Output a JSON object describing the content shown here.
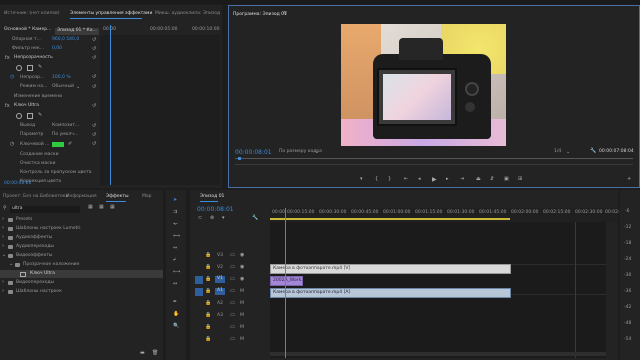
{
  "source_panel": {
    "tabs": [
      "Источник: (нет клипов)",
      "Элементы управления эффектами",
      "Микш. аудиоклипа: Эпизод"
    ],
    "clip_label": "Основной * Камер...",
    "seq_label": "Эпизод 01 * Ка...",
    "ruler_times": [
      "00:00",
      "00:00:05:00",
      "00:00:10:00"
    ],
    "props": [
      {
        "label": "Опорная т...",
        "value": "960,0  540,0"
      },
      {
        "label": "Фильтр нек...",
        "value": "0,00"
      }
    ],
    "opacity_label": "Непрозрачность",
    "opacity_value_label": "Непрозр...",
    "opacity_value": "100,0 %",
    "blend_label": "Режим на...",
    "blend_value": "Обычный",
    "time_remap": "Изменение времени",
    "ultra_key": "Ключ Ultra",
    "output_label": "Выход",
    "output_value": "Композит...",
    "setting_label": "Параметр",
    "setting_value": "По умолч...",
    "key_color_label": "Ключевой ...",
    "key_color": "#2ecc40",
    "sub_items": [
      "Создание маски",
      "Очистка маски",
      "Контроль за пропуском цвета",
      "Коррекция цвета"
    ],
    "timecode": "00:00:08:01"
  },
  "program_monitor": {
    "title": "Программа: Эпизод 01",
    "menu_icon": "menu-icon",
    "timecode": "00:00:08:01",
    "fit": "По размеру кадра",
    "quality": "1/4",
    "duration": "00:00:07:08:04"
  },
  "project_panel": {
    "tabs": [
      "Проект: Без на...",
      "Библиотеки",
      "Информация",
      "Эффекты",
      "Мар"
    ],
    "search": "ultra",
    "tree": [
      {
        "label": "Presets",
        "level": 0
      },
      {
        "label": "Шаблоны настроек Lumetri",
        "level": 0
      },
      {
        "label": "Аудиоэффекты",
        "level": 0
      },
      {
        "label": "Аудиопереходы",
        "level": 0
      },
      {
        "label": "Видеоэффекты",
        "level": 0
      },
      {
        "label": "Прозрачное наложение",
        "level": 1
      },
      {
        "label": "Ключ Ultra",
        "level": 2
      },
      {
        "label": "Видеопереходы",
        "level": 0
      },
      {
        "label": "Шаблоны настроек",
        "level": 0
      }
    ]
  },
  "timeline": {
    "tab": "Эпизод 01",
    "timecode": "00:00:08:01",
    "ruler": [
      "00:00",
      "00:00:15:00",
      "00:00:30:00",
      "00:00:45:00",
      "00:01:00:00",
      "00:01:15:00",
      "00:01:30:00",
      "00:01:45:00",
      "00:02:00:00",
      "00:02:15:00",
      "00:02:30:00",
      "00:02:45:00"
    ],
    "tracks": [
      "V3",
      "V2",
      "V1",
      "A1",
      "A2",
      "A3",
      ""
    ],
    "clips": {
      "v2": "Камера в фотоаппарате.mp4 [V]",
      "v1": "2002A_Work...",
      "a1": "Камера в фотоаппарате.mp4 [A]"
    }
  },
  "meter_scale": [
    "-6",
    "-12",
    "-18",
    "-24",
    "-30",
    "-36",
    "-42",
    "-48",
    "-54"
  ]
}
